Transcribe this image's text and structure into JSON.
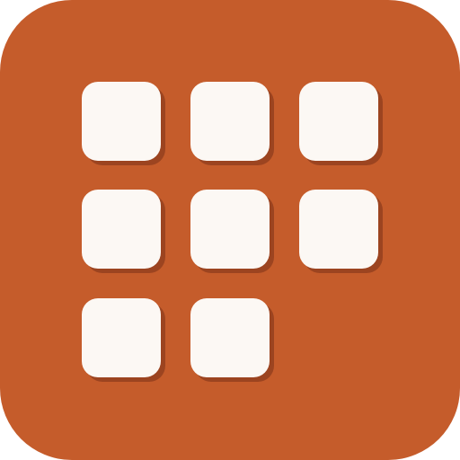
{
  "icon": {
    "name": "app-grid-icon",
    "background_color": "#c55c2b",
    "tile_color": "#fcf8f4",
    "shadow_color": "#9c4420",
    "tile_count": 8
  },
  "tiles": [
    {
      "id": "tile-1",
      "row": 1,
      "col": 1
    },
    {
      "id": "tile-2",
      "row": 1,
      "col": 2
    },
    {
      "id": "tile-3",
      "row": 1,
      "col": 3
    },
    {
      "id": "tile-4",
      "row": 2,
      "col": 1
    },
    {
      "id": "tile-5",
      "row": 2,
      "col": 2
    },
    {
      "id": "tile-6",
      "row": 2,
      "col": 3
    },
    {
      "id": "tile-7",
      "row": 3,
      "col": 1
    },
    {
      "id": "tile-8",
      "row": 3,
      "col": 2
    }
  ]
}
